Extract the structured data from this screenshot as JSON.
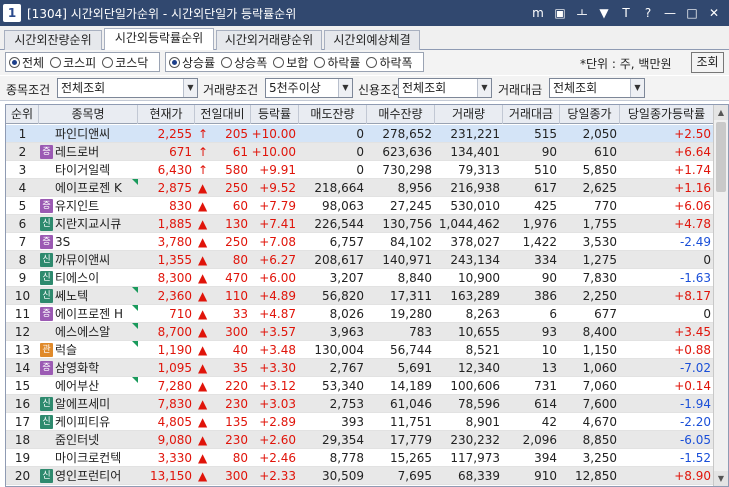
{
  "window": {
    "number": "1",
    "title": "[1304] 시간외단일가순위 - 시간외단일가 등락률순위",
    "icons": [
      "m-icon",
      "restore-icon",
      "help-icon",
      "pin-icon",
      "text-icon",
      "question-icon",
      "minimize-icon",
      "maximize-icon",
      "close-icon"
    ],
    "icon_glyphs": [
      "m",
      "▣",
      "ㅗ",
      "▼",
      "T",
      "?",
      "—",
      "□",
      "✕"
    ]
  },
  "tabs": [
    {
      "label": "시간외잔량순위",
      "active": false
    },
    {
      "label": "시간외등락률순위",
      "active": true
    },
    {
      "label": "시간외거래량순위",
      "active": false
    },
    {
      "label": "시간외예상체결",
      "active": false
    }
  ],
  "market_filter": {
    "options": [
      "전체",
      "코스피",
      "코스닥"
    ],
    "selected": "전체"
  },
  "direction_filter": {
    "options": [
      "상승률",
      "상승폭",
      "보합",
      "하락률",
      "하락폭"
    ],
    "selected": "상승률"
  },
  "unit_label": "*단위 : 주, 백만원",
  "query_button": "조회",
  "conditions": {
    "stock_label": "종목조건",
    "stock_value": "전체조회",
    "volume_label": "거래량조건",
    "volume_value": "5천주이상",
    "credit_label": "신용조건",
    "credit_value": "전체조회",
    "amount_label": "거래대금",
    "amount_value": "전체조회"
  },
  "columns": [
    "순위",
    "종목명",
    "현재가",
    "전일대비",
    "등락률",
    "매도잔량",
    "매수잔량",
    "거래량",
    "거래대금",
    "당일종가",
    "당일종가등락률"
  ],
  "rows": [
    {
      "rank": "1",
      "badge": "",
      "name": "파인디앤씨",
      "flag": false,
      "price": "2,255",
      "arrow": "↑",
      "change": "205",
      "rate": "+10.00",
      "sell": "0",
      "buy": "278,652",
      "volume": "231,221",
      "amount": "515",
      "close": "2,050",
      "close_rate": "+2.50",
      "close_dir": "up"
    },
    {
      "rank": "2",
      "badge": "증",
      "name": "레드로버",
      "flag": false,
      "price": "671",
      "arrow": "↑",
      "change": "61",
      "rate": "+10.00",
      "sell": "0",
      "buy": "623,636",
      "volume": "134,401",
      "amount": "90",
      "close": "610",
      "close_rate": "+6.64",
      "close_dir": "up"
    },
    {
      "rank": "3",
      "badge": "",
      "name": "타이거일렉",
      "flag": false,
      "price": "6,430",
      "arrow": "↑",
      "change": "580",
      "rate": "+9.91",
      "sell": "0",
      "buy": "730,298",
      "volume": "79,313",
      "amount": "510",
      "close": "5,850",
      "close_rate": "+1.74",
      "close_dir": "up"
    },
    {
      "rank": "4",
      "badge": "",
      "name": "에이프로젠 K",
      "flag": true,
      "price": "2,875",
      "arrow": "▲",
      "change": "250",
      "rate": "+9.52",
      "sell": "218,664",
      "buy": "8,956",
      "volume": "216,938",
      "amount": "617",
      "close": "2,625",
      "close_rate": "+1.16",
      "close_dir": "up"
    },
    {
      "rank": "5",
      "badge": "증",
      "name": "유지인트",
      "flag": false,
      "price": "830",
      "arrow": "▲",
      "change": "60",
      "rate": "+7.79",
      "sell": "98,063",
      "buy": "27,245",
      "volume": "530,010",
      "amount": "425",
      "close": "770",
      "close_rate": "+6.06",
      "close_dir": "up"
    },
    {
      "rank": "6",
      "badge": "신",
      "name": "지란지교시큐",
      "flag": false,
      "price": "1,885",
      "arrow": "▲",
      "change": "130",
      "rate": "+7.41",
      "sell": "226,544",
      "buy": "130,756",
      "volume": "1,044,462",
      "amount": "1,976",
      "close": "1,755",
      "close_rate": "+4.78",
      "close_dir": "up"
    },
    {
      "rank": "7",
      "badge": "증",
      "name": "3S",
      "flag": false,
      "price": "3,780",
      "arrow": "▲",
      "change": "250",
      "rate": "+7.08",
      "sell": "6,757",
      "buy": "84,102",
      "volume": "378,027",
      "amount": "1,422",
      "close": "3,530",
      "close_rate": "-2.49",
      "close_dir": "down"
    },
    {
      "rank": "8",
      "badge": "신",
      "name": "까뮤이앤씨",
      "flag": false,
      "price": "1,355",
      "arrow": "▲",
      "change": "80",
      "rate": "+6.27",
      "sell": "208,617",
      "buy": "140,971",
      "volume": "243,134",
      "amount": "334",
      "close": "1,275",
      "close_rate": "0",
      "close_dir": "flat"
    },
    {
      "rank": "9",
      "badge": "신",
      "name": "티에스이",
      "flag": false,
      "price": "8,300",
      "arrow": "▲",
      "change": "470",
      "rate": "+6.00",
      "sell": "3,207",
      "buy": "8,840",
      "volume": "10,900",
      "amount": "90",
      "close": "7,830",
      "close_rate": "-1.63",
      "close_dir": "down"
    },
    {
      "rank": "10",
      "badge": "신",
      "name": "쎄노텍",
      "flag": true,
      "price": "2,360",
      "arrow": "▲",
      "change": "110",
      "rate": "+4.89",
      "sell": "56,820",
      "buy": "17,311",
      "volume": "163,289",
      "amount": "386",
      "close": "2,250",
      "close_rate": "+8.17",
      "close_dir": "up"
    },
    {
      "rank": "11",
      "badge": "증",
      "name": "에이프로젠 H",
      "flag": true,
      "price": "710",
      "arrow": "▲",
      "change": "33",
      "rate": "+4.87",
      "sell": "8,026",
      "buy": "19,280",
      "volume": "8,263",
      "amount": "6",
      "close": "677",
      "close_rate": "0",
      "close_dir": "flat"
    },
    {
      "rank": "12",
      "badge": "",
      "name": "에스에스알",
      "flag": true,
      "price": "8,700",
      "arrow": "▲",
      "change": "300",
      "rate": "+3.57",
      "sell": "3,963",
      "buy": "783",
      "volume": "10,655",
      "amount": "93",
      "close": "8,400",
      "close_rate": "+3.45",
      "close_dir": "up"
    },
    {
      "rank": "13",
      "badge": "관",
      "name": "럭슬",
      "flag": true,
      "price": "1,190",
      "arrow": "▲",
      "change": "40",
      "rate": "+3.48",
      "sell": "130,004",
      "buy": "56,744",
      "volume": "8,521",
      "amount": "10",
      "close": "1,150",
      "close_rate": "+0.88",
      "close_dir": "up"
    },
    {
      "rank": "14",
      "badge": "증",
      "name": "삼영화학",
      "flag": false,
      "price": "1,095",
      "arrow": "▲",
      "change": "35",
      "rate": "+3.30",
      "sell": "2,767",
      "buy": "5,691",
      "volume": "12,340",
      "amount": "13",
      "close": "1,060",
      "close_rate": "-7.02",
      "close_dir": "down"
    },
    {
      "rank": "15",
      "badge": "",
      "name": "에어부산",
      "flag": true,
      "price": "7,280",
      "arrow": "▲",
      "change": "220",
      "rate": "+3.12",
      "sell": "53,340",
      "buy": "14,189",
      "volume": "100,606",
      "amount": "731",
      "close": "7,060",
      "close_rate": "+0.14",
      "close_dir": "up"
    },
    {
      "rank": "16",
      "badge": "신",
      "name": "알에프세미",
      "flag": false,
      "price": "7,830",
      "arrow": "▲",
      "change": "230",
      "rate": "+3.03",
      "sell": "2,753",
      "buy": "61,046",
      "volume": "78,596",
      "amount": "614",
      "close": "7,600",
      "close_rate": "-1.94",
      "close_dir": "down"
    },
    {
      "rank": "17",
      "badge": "신",
      "name": "케이피티유",
      "flag": false,
      "price": "4,805",
      "arrow": "▲",
      "change": "135",
      "rate": "+2.89",
      "sell": "393",
      "buy": "11,751",
      "volume": "8,901",
      "amount": "42",
      "close": "4,670",
      "close_rate": "-2.20",
      "close_dir": "down"
    },
    {
      "rank": "18",
      "badge": "",
      "name": "줌인터넷",
      "flag": false,
      "price": "9,080",
      "arrow": "▲",
      "change": "230",
      "rate": "+2.60",
      "sell": "29,354",
      "buy": "17,779",
      "volume": "230,232",
      "amount": "2,096",
      "close": "8,850",
      "close_rate": "-6.05",
      "close_dir": "down"
    },
    {
      "rank": "19",
      "badge": "",
      "name": "마이크로컨텍",
      "flag": false,
      "price": "3,330",
      "arrow": "▲",
      "change": "80",
      "rate": "+2.46",
      "sell": "8,778",
      "buy": "15,265",
      "volume": "117,973",
      "amount": "394",
      "close": "3,250",
      "close_rate": "-1.52",
      "close_dir": "down"
    },
    {
      "rank": "20",
      "badge": "신",
      "name": "영인프런티어",
      "flag": false,
      "price": "13,150",
      "arrow": "▲",
      "change": "300",
      "rate": "+2.33",
      "sell": "30,509",
      "buy": "7,695",
      "volume": "68,339",
      "amount": "910",
      "close": "12,850",
      "close_rate": "+8.90",
      "close_dir": "up"
    }
  ]
}
